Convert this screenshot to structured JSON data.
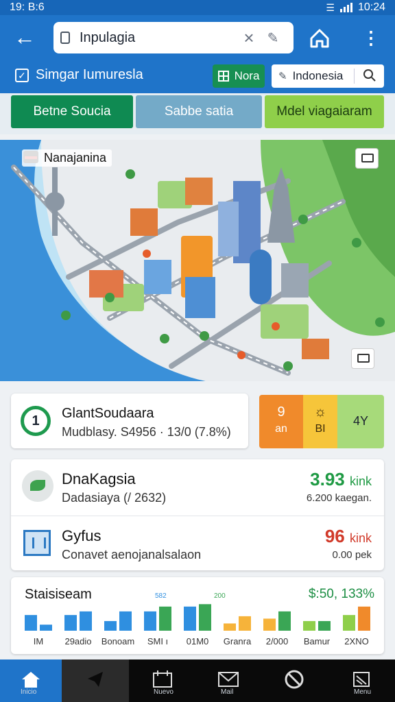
{
  "status": {
    "time_left": "19: B:6",
    "time_right": "10:24"
  },
  "header": {
    "search_value": "Inpulagia",
    "sub_label": "Simgar Iumuresla",
    "nora_label": "Nora",
    "region_label": "Indonesia"
  },
  "tabs": [
    "Betne Soucia",
    "Sabbe satia",
    "Mdel viagaiaram"
  ],
  "map": {
    "title": "Nanajanina"
  },
  "card1": {
    "number": "1",
    "title": "GlantSoudaara",
    "subtitle": "Mudblasy. S4956 · 13/0 (7.8%)"
  },
  "weather": {
    "a_top": "9",
    "a_bot": "an",
    "b_bot": "BI",
    "c_mid": "4Y"
  },
  "rows": [
    {
      "title": "DnaKagsia",
      "subtitle": "Dadasiaya (/ 2632)",
      "value": "3.93",
      "unit": "kink",
      "sub": "6.200 kaegan.",
      "color": "#1f9a44"
    },
    {
      "title": "Gyfus",
      "subtitle": "Conavet aenojanalsalaon",
      "value": "96",
      "unit": "kink",
      "sub": "0.00 pek",
      "color": "#d13a2a"
    }
  ],
  "stats": {
    "title": "Staisiseam",
    "value": "$:50, 133%",
    "labels": [
      "IM",
      "29adio",
      "Bonoam",
      "SMI ı",
      "01M0",
      "Granra",
      "2/000",
      "Bamur",
      "2XNO"
    ],
    "small_labels": [
      "582",
      "200"
    ]
  },
  "chart_data": {
    "type": "bar",
    "title": "Staisiseam",
    "categories": [
      "IM",
      "29adio",
      "Bonoam",
      "SMI ı",
      "01M0",
      "Granra",
      "2/000",
      "Bamur",
      "2XNO"
    ],
    "series": [
      {
        "values": [
          26,
          26,
          16,
          32,
          40,
          12,
          20,
          16,
          26
        ]
      },
      {
        "values": [
          10,
          32,
          32,
          40,
          44,
          24,
          32,
          16,
          40
        ]
      }
    ],
    "ylim": [
      0,
      50
    ]
  },
  "nav": {
    "home_label": "Inicio",
    "items": [
      "",
      "Nuevo",
      "Mail",
      "",
      "Menu"
    ]
  }
}
